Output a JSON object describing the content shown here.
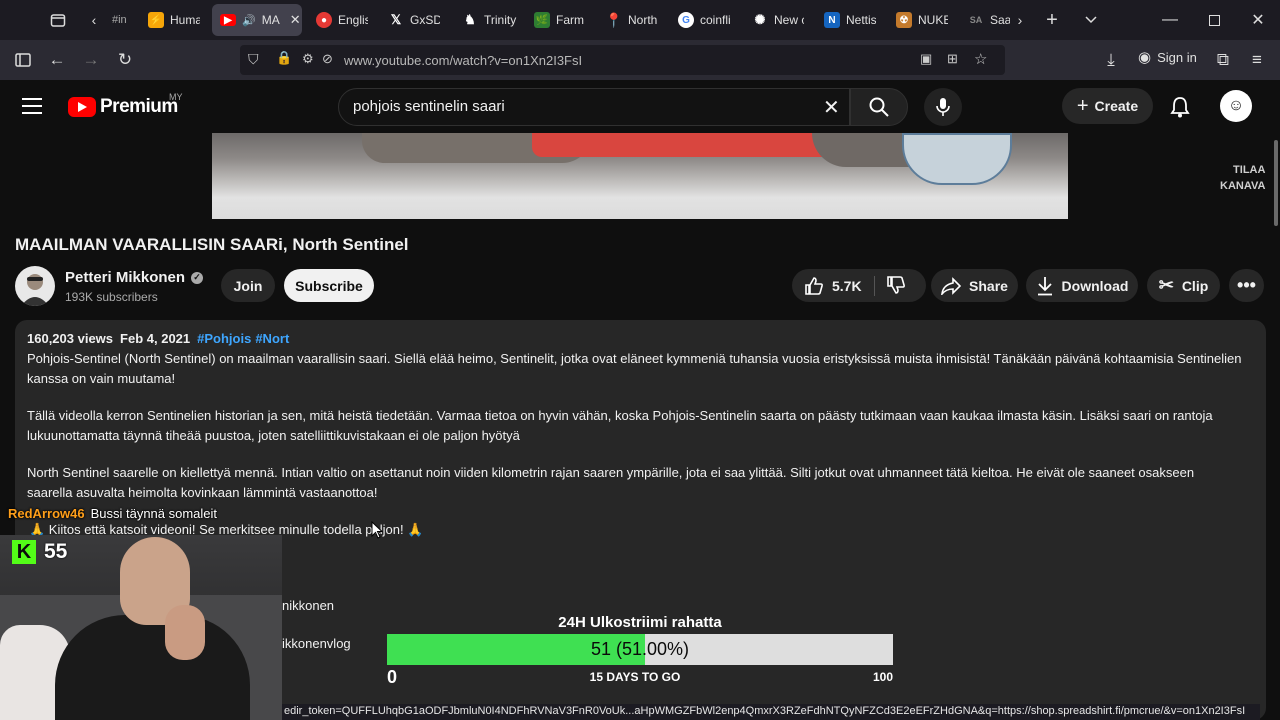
{
  "browser": {
    "tabs": [
      {
        "label": "#in",
        "icon": "list-icon",
        "color": "#3c3b44"
      },
      {
        "label": "Huma",
        "icon": "bolt-icon",
        "color": "#f6a609"
      },
      {
        "label": "MA",
        "icon": "youtube-icon",
        "color": "#ff0000"
      },
      {
        "label": "Englis",
        "icon": "globe-icon",
        "color": "#e53935"
      },
      {
        "label": "GxSD",
        "icon": "x-icon",
        "color": "#000000"
      },
      {
        "label": "Trinity",
        "icon": "chess-icon",
        "color": "#3c3b44"
      },
      {
        "label": "Farm",
        "icon": "farm-icon",
        "color": "#2e7d32"
      },
      {
        "label": "North",
        "icon": "map-pin-icon",
        "color": "#34a853"
      },
      {
        "label": "coinfli",
        "icon": "google-icon",
        "color": "#ffffff"
      },
      {
        "label": "New c",
        "icon": "chatgpt-icon",
        "color": "#3c3b44"
      },
      {
        "label": "Nettis",
        "icon": "n-icon",
        "color": "#1565c0"
      },
      {
        "label": "NUKE",
        "icon": "nuke-icon",
        "color": "#c47a2c"
      },
      {
        "label": "Saa",
        "icon": "sa-icon",
        "color": "#3c3b44"
      }
    ],
    "url": "www.youtube.com/watch?v=on1Xn2I3FsI",
    "sign_in": "Sign in"
  },
  "youtube": {
    "logo": "Premium",
    "region": "MY",
    "search_value": "pohjois sentinelin saari",
    "create": "Create",
    "overlay_line1": "TILAA",
    "overlay_line2": "KANAVA"
  },
  "video": {
    "title": "MAAILMAN VAARALLISIN SAARi, North Sentinel",
    "channel": "Petteri Mikkonen",
    "subscribers": "193K subscribers",
    "join": "Join",
    "subscribe": "Subscribe",
    "likes": "5.7K",
    "share": "Share",
    "download": "Download",
    "clip": "Clip"
  },
  "description": {
    "views": "160,203 views",
    "date": "Feb 4, 2021",
    "hashtag1": "#Pohjois",
    "hashtag2": "#Nort",
    "p1": "Pohjois-Sentinel (North Sentinel) on maailman vaarallisin saari. Siellä elää heimo, Sentinelit, jotka ovat eläneet kymmeniä tuhansia vuosia eristyksissä muista ihmisistä! Tänäkään päivänä kohtaamisia Sentinelien kanssa on vain muutama!",
    "p2": "Tällä videolla kerron Sentinelien historian ja sen, mitä heistä tiedetään. Varmaa tietoa on hyvin vähän, koska Pohjois-Sentinelin saarta on päästy tutkimaan vaan kaukaa ilmasta käsin. Lisäksi saari on rantoja lukuunottamatta täynnä tiheää puustoa, joten satelliittikuvistakaan ei ole paljon hyötyä",
    "p3": "North Sentinel saarelle on kiellettyä mennä. Intian valtio on asettanut noin viiden kilometrin rajan saaren ympärille, jota ei saa ylittää. Silti jotkut ovat uhmanneet tätä kieltoa. He eivät ole saaneet osakseen saarella asuvalta heimolta kovinkaan lämmintä vastaanottoa!",
    "p4": "🙏 Kiitos että katsoit videoni! Se merkitsee minulle todella paljon! 🙏",
    "side_name_1": "nikkonen",
    "side_name_2": "ikkonenvlog"
  },
  "stream": {
    "chat_user": "RedArrow46",
    "chat_message": "Bussi täynnä somaleit",
    "kick_logo": "K",
    "viewer_count": "55",
    "goal_title": "24H Ulkostriimi rahatta",
    "goal_value_text": "51 (51.00%)",
    "goal_fraction": 0.51,
    "goal_min": "0",
    "goal_max": "100",
    "goal_days": "15 DAYS TO GO",
    "goal_fill_color": "#3fe052"
  },
  "status_bar_url": "edir_token=QUFFLUhqbG1aODFJbmluN0I4NDFhRVNaV3FnR0VoUk...aHpWMGZFbWl2enp4QmxrX3RZeFdhNTQyNFZCd3E2eEFrZHdGNA&q=https://shop.spreadshirt.fi/pmcrue/&v=on1Xn2I3FsI",
  "colors": {
    "youtube_red": "#ff0000",
    "link_blue": "#3ea6ff",
    "kick_green": "#53fc18"
  }
}
